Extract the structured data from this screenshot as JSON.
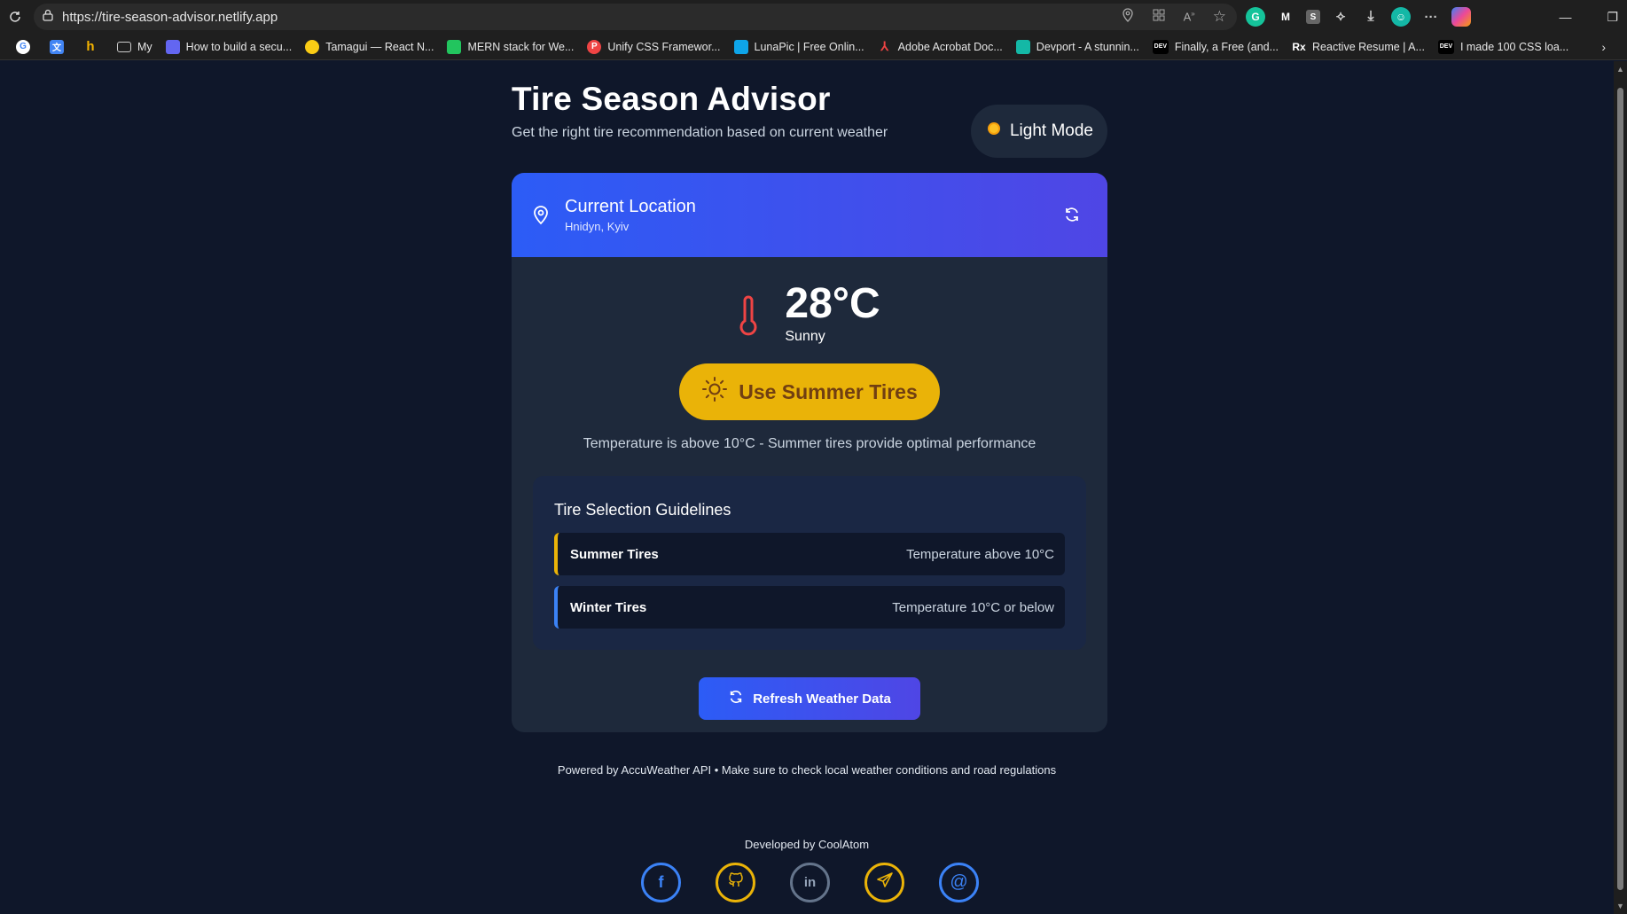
{
  "browser": {
    "url": "https://tire-season-advisor.netlify.app",
    "bookmarks": [
      {
        "label": "",
        "icon": "google-icon"
      },
      {
        "label": "",
        "icon": "translate-icon"
      },
      {
        "label": "",
        "icon": "h-icon"
      },
      {
        "label": "My",
        "icon": "folder-icon"
      },
      {
        "label": "How to build a secu...",
        "icon": "page-icon"
      },
      {
        "label": "Tamagui — React N...",
        "icon": "tamagui-icon"
      },
      {
        "label": "MERN stack for We...",
        "icon": "mern-icon"
      },
      {
        "label": "Unify CSS Framewor...",
        "icon": "unify-icon"
      },
      {
        "label": "LunaPic | Free Onlin...",
        "icon": "lunapic-icon"
      },
      {
        "label": "Adobe Acrobat Doc...",
        "icon": "acrobat-icon"
      },
      {
        "label": "Devport - A stunnin...",
        "icon": "devport-icon"
      },
      {
        "label": "Finally, a Free (and...",
        "icon": "dev-icon"
      },
      {
        "label": "Reactive Resume | A...",
        "icon": "rx-icon"
      },
      {
        "label": "I made 100 CSS loa...",
        "icon": "dev-icon"
      }
    ]
  },
  "app": {
    "title": "Tire Season Advisor",
    "subtitle": "Get the right tire recommendation based on current weather",
    "mode_button": "Light Mode"
  },
  "location": {
    "heading": "Current Location",
    "name": "Hnidyn, Kyiv"
  },
  "weather": {
    "temperature": "28°C",
    "condition": "Sunny"
  },
  "recommendation": {
    "label": "Use Summer Tires",
    "note": "Temperature is above 10°C - Summer tires provide optimal performance"
  },
  "guidelines": {
    "title": "Tire Selection Guidelines",
    "items": [
      {
        "name": "Summer Tires",
        "desc": "Temperature above 10°C",
        "color": "#eab308"
      },
      {
        "name": "Winter Tires",
        "desc": "Temperature 10°C or below",
        "color": "#3b82f6"
      }
    ]
  },
  "refresh_button": "Refresh Weather Data",
  "footer": {
    "powered": "Powered by AccuWeather API • Make sure to check local weather conditions and road regulations",
    "developed": "Developed by CoolAtom",
    "socials": [
      {
        "icon": "facebook-icon",
        "color": "#3b82f6"
      },
      {
        "icon": "github-icon",
        "color": "#eab308"
      },
      {
        "icon": "linkedin-icon",
        "color": "#64748b"
      },
      {
        "icon": "telegram-icon",
        "color": "#eab308"
      },
      {
        "icon": "email-icon",
        "color": "#3b82f6"
      }
    ]
  },
  "colors": {
    "background": "#0f172a",
    "card": "#1e293b",
    "accent": "#2c5cf6",
    "summer": "#eab308"
  }
}
